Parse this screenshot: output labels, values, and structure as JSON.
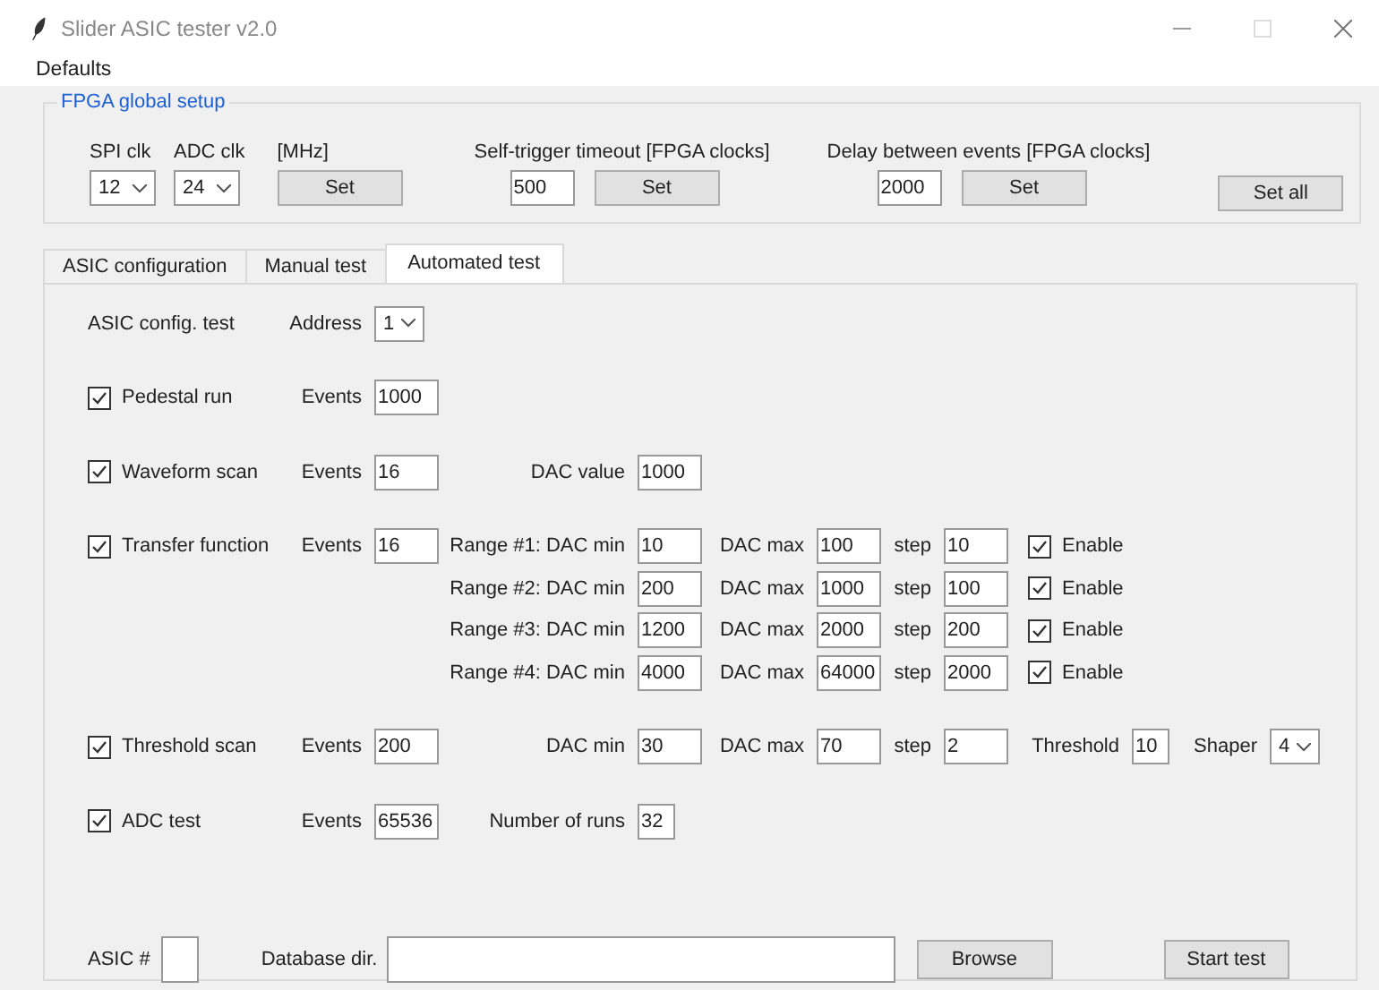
{
  "window": {
    "title": "Slider ASIC tester v2.0"
  },
  "menu": [
    "Defaults"
  ],
  "fpga_setup": {
    "title": "FPGA global setup",
    "spi_clk": {
      "label": "SPI clk",
      "value": "12"
    },
    "adc_clk": {
      "label": "ADC clk",
      "value": "24"
    },
    "clk_unit": "[MHz]",
    "clk_button": "Set",
    "timeout": {
      "label": "Self-trigger timeout [FPGA clocks]",
      "value": "500",
      "button": "Set"
    },
    "delay": {
      "label": "Delay between events [FPGA clocks]",
      "value": "2000",
      "button": "Set"
    },
    "set_all": "Set all"
  },
  "tabs": [
    {
      "label": "ASIC configuration",
      "selected": false
    },
    {
      "label": "Manual test",
      "selected": false
    },
    {
      "label": "Automated test",
      "selected": true
    }
  ],
  "automated_test": {
    "rows": [
      {
        "kind": "plain",
        "label": "ASIC config. test",
        "fields": [
          {
            "kind": "select",
            "label": "Address",
            "value": "1"
          }
        ]
      },
      {
        "kind": "check",
        "label": "Pedestal run",
        "checked": true,
        "fields": [
          {
            "kind": "entry",
            "label": "Events",
            "value": "1000"
          }
        ]
      },
      {
        "kind": "check",
        "label": "Waveform scan",
        "checked": true,
        "fields": [
          {
            "kind": "entry",
            "label": "Events",
            "value": "16"
          },
          {
            "kind": "entry",
            "label": "DAC value",
            "value": "1000"
          }
        ]
      },
      {
        "kind": "check",
        "label": "Transfer function",
        "checked": true,
        "fields": [
          {
            "kind": "entry",
            "label": "Events",
            "value": "16"
          }
        ],
        "ranges": [
          {
            "fields": [
              {
                "kind": "entry",
                "label": "Range #1: DAC min",
                "value": "10"
              },
              {
                "kind": "entry",
                "label": "DAC max",
                "value": "100"
              },
              {
                "kind": "entry",
                "label": "step",
                "value": "10"
              },
              {
                "kind": "check",
                "label": "Enable",
                "checked": true
              }
            ]
          },
          {
            "fields": [
              {
                "kind": "entry",
                "label": "Range #2: DAC min",
                "value": "200"
              },
              {
                "kind": "entry",
                "label": "DAC max",
                "value": "1000"
              },
              {
                "kind": "entry",
                "label": "step",
                "value": "100"
              },
              {
                "kind": "check",
                "label": "Enable",
                "checked": true
              }
            ]
          },
          {
            "fields": [
              {
                "kind": "entry",
                "label": "Range #3: DAC min",
                "value": "1200"
              },
              {
                "kind": "entry",
                "label": "DAC max",
                "value": "2000"
              },
              {
                "kind": "entry",
                "label": "step",
                "value": "200"
              },
              {
                "kind": "check",
                "label": "Enable",
                "checked": true
              }
            ]
          },
          {
            "fields": [
              {
                "kind": "entry",
                "label": "Range #4: DAC min",
                "value": "4000"
              },
              {
                "kind": "entry",
                "label": "DAC max",
                "value": "64000"
              },
              {
                "kind": "entry",
                "label": "step",
                "value": "2000"
              },
              {
                "kind": "check",
                "label": "Enable",
                "checked": true
              }
            ]
          }
        ]
      },
      {
        "kind": "check",
        "label": "Threshold scan",
        "checked": true,
        "fields": [
          {
            "kind": "entry",
            "label": "Events",
            "value": "200"
          },
          {
            "kind": "entry",
            "label": "DAC min",
            "value": "30"
          },
          {
            "kind": "entry",
            "label": "DAC max",
            "value": "70"
          },
          {
            "kind": "entry",
            "label": "step",
            "value": "2"
          },
          {
            "kind": "narrow",
            "label": "Threshold",
            "value": "10"
          },
          {
            "kind": "select",
            "label": "Shaper",
            "value": "4"
          }
        ]
      },
      {
        "kind": "check",
        "label": "ADC test",
        "checked": true,
        "fields": [
          {
            "kind": "entry",
            "label": "Events",
            "value": "65536"
          },
          {
            "kind": "narrow",
            "label": "Number of runs",
            "value": "32"
          }
        ]
      }
    ],
    "asic_label": "ASIC #",
    "db_label": "Database dir.",
    "browse": "Browse",
    "start": "Start test"
  }
}
